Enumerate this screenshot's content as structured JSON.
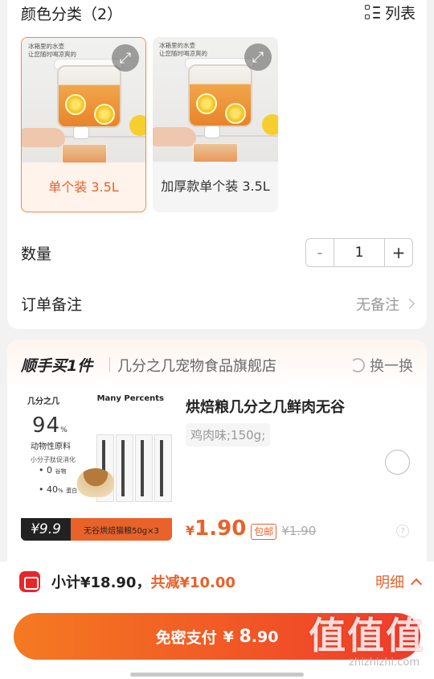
{
  "spec": {
    "title": "颜色分类（2）",
    "view_toggle": "列表",
    "options": [
      {
        "label": "单个装 3.5L",
        "selected": true,
        "ad_line1": "冰箱里的水壶",
        "ad_line2": "让您随时喝凉爽的"
      },
      {
        "label": "加厚款单个装 3.5L",
        "selected": false,
        "ad_line1": "冰箱里的水壶",
        "ad_line2": "让您随时喝凉爽的"
      }
    ]
  },
  "quantity": {
    "label": "数量",
    "minus": "-",
    "value": "1",
    "plus": "+"
  },
  "note": {
    "label": "订单备注",
    "value": "无备注"
  },
  "addon": {
    "title": "顺手买1件",
    "store": "几分之几宠物食品旗舰店",
    "swap": "换一换",
    "product": {
      "name": "烘焙粮几分之几鲜肉无谷",
      "spec": "鸡肉味;150g;",
      "currency": "¥",
      "price": "1.90",
      "tag": "包邮",
      "original_price": "¥1.90",
      "image": {
        "brand_cn": "几分之几",
        "brand_en": "Many Percents",
        "percent": "94",
        "percent_unit": "%",
        "desc": "动物性原料",
        "sub": "小分子肽促消化",
        "b1_num": "0",
        "b1_txt": "谷物",
        "b2_num": "40",
        "b2_unit": "%",
        "b2_txt": "蛋白",
        "strip_price": "¥9.9",
        "strip_text": "无谷烘焙猫粮50g×3"
      }
    }
  },
  "summary": {
    "subtotal": "小计¥18.90，",
    "reduce": "共减¥10.00",
    "detail": "明细"
  },
  "pay": {
    "label": "免密支付",
    "currency": "¥",
    "int": "8",
    "dec": ".90"
  },
  "watermark": {
    "text": "值值值",
    "url": "zhizhizhi.com"
  },
  "colors": {
    "accent": "#e8622a",
    "pay_start": "#f47a21",
    "pay_end": "#ef3b2a",
    "logo": "#e8262a"
  },
  "icons": [
    "list-icon",
    "expand-icon",
    "chevron-right-icon",
    "swap-icon",
    "radio-unchecked-icon",
    "help-icon",
    "logo-icon",
    "chevron-up-icon"
  ]
}
